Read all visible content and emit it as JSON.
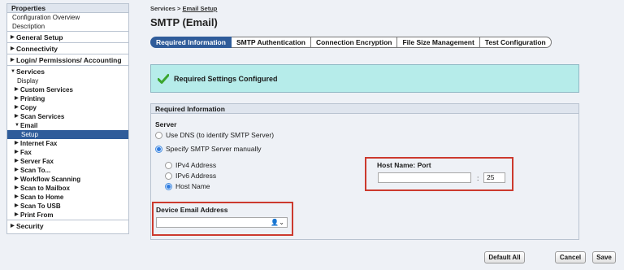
{
  "sidebar": {
    "header": "Properties",
    "top_items": [
      "Configuration Overview",
      "Description"
    ],
    "groups": {
      "general_setup": "General Setup",
      "connectivity": "Connectivity",
      "login": "Login/ Permissions/ Accounting",
      "services": "Services",
      "security": "Security"
    },
    "services_items": {
      "display": "Display",
      "custom_services": "Custom Services",
      "printing": "Printing",
      "copy": "Copy",
      "scan_services": "Scan Services",
      "email": "Email",
      "setup": "Setup",
      "internet_fax": "Internet Fax",
      "fax": "Fax",
      "server_fax": "Server Fax",
      "scan_to": "Scan To...",
      "workflow_scanning": "Workflow Scanning",
      "scan_to_mailbox": "Scan to Mailbox",
      "scan_to_home": "Scan to Home",
      "scan_to_usb": "Scan To USB",
      "print_from": "Print From"
    }
  },
  "breadcrumb": {
    "root": "Services",
    "sep": ">",
    "current": "Email Setup"
  },
  "page_title": "SMTP (Email)",
  "tabs": [
    "Required Information",
    "SMTP Authentication",
    "Connection Encryption",
    "File Size Management",
    "Test Configuration"
  ],
  "status": {
    "text": "Required Settings Configured",
    "icon": "checkmark-icon"
  },
  "panel": {
    "header": "Required Information",
    "server_label": "Server",
    "use_dns": "Use DNS (to identify SMTP Server)",
    "specify_manual": "Specify SMTP Server manually",
    "ipv4": "IPv4 Address",
    "ipv6": "IPv6 Address",
    "host_name": "Host Name",
    "host_port_label": "Host Name: Port",
    "host_value": "",
    "port_colon": ":",
    "port_value": "25",
    "device_email_label": "Device Email Address",
    "device_email_value": ""
  },
  "buttons": {
    "default_all": "Default All",
    "cancel": "Cancel",
    "save": "Save"
  },
  "colors": {
    "accent": "#2f5c9a",
    "status_bg": "#b6ecea",
    "highlight_border": "#cc3a2e"
  }
}
